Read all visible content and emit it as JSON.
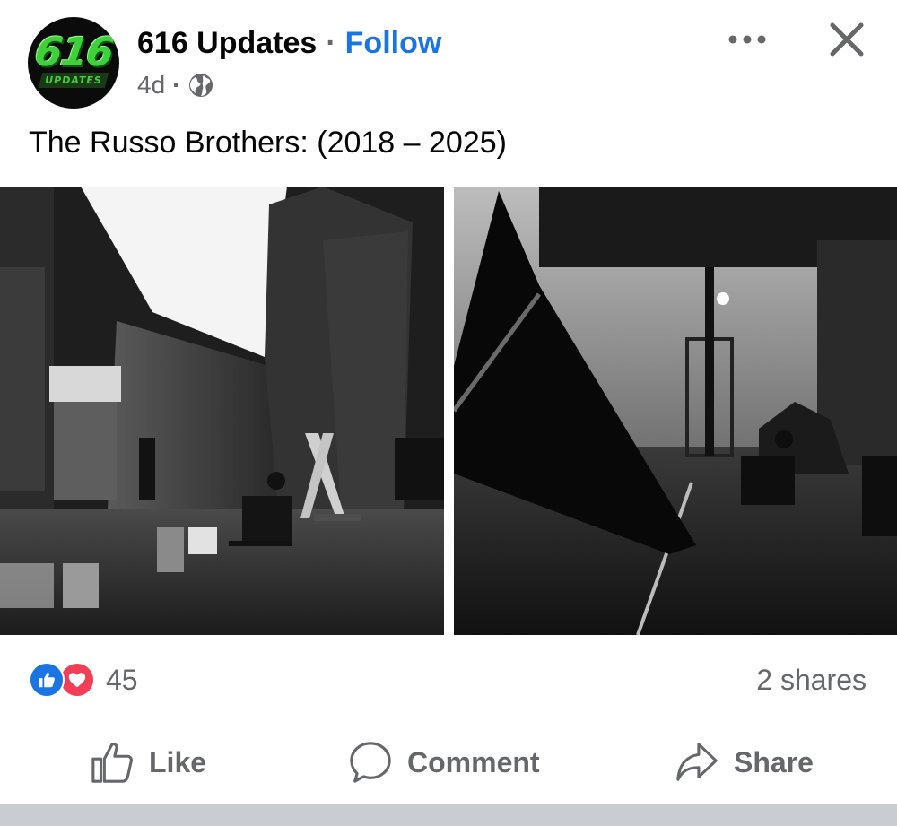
{
  "post": {
    "page_name": "616 Updates",
    "separator": "·",
    "follow_label": "Follow",
    "time_ago": "4d",
    "meta_dot": "·",
    "audience_icon": "globe-icon",
    "avatar_logo_number": "616",
    "avatar_logo_sub": "UPDATES",
    "caption": "The Russo Brothers: (2018 – 2025)",
    "more_icon": "more-horizontal-icon",
    "close_icon": "close-icon"
  },
  "photos": [
    {
      "description_icon": "photo-1",
      "tone": "grayscale"
    },
    {
      "description_icon": "photo-2",
      "tone": "grayscale"
    }
  ],
  "stats": {
    "reaction_types": [
      "like",
      "love"
    ],
    "reaction_count": "45",
    "shares_label": "2 shares"
  },
  "actions": {
    "like_label": "Like",
    "comment_label": "Comment",
    "share_label": "Share"
  },
  "colors": {
    "accent": "#1b74e4",
    "love": "#f33e58",
    "muted_text": "#65676b",
    "logo_green": "#3fd13a"
  }
}
